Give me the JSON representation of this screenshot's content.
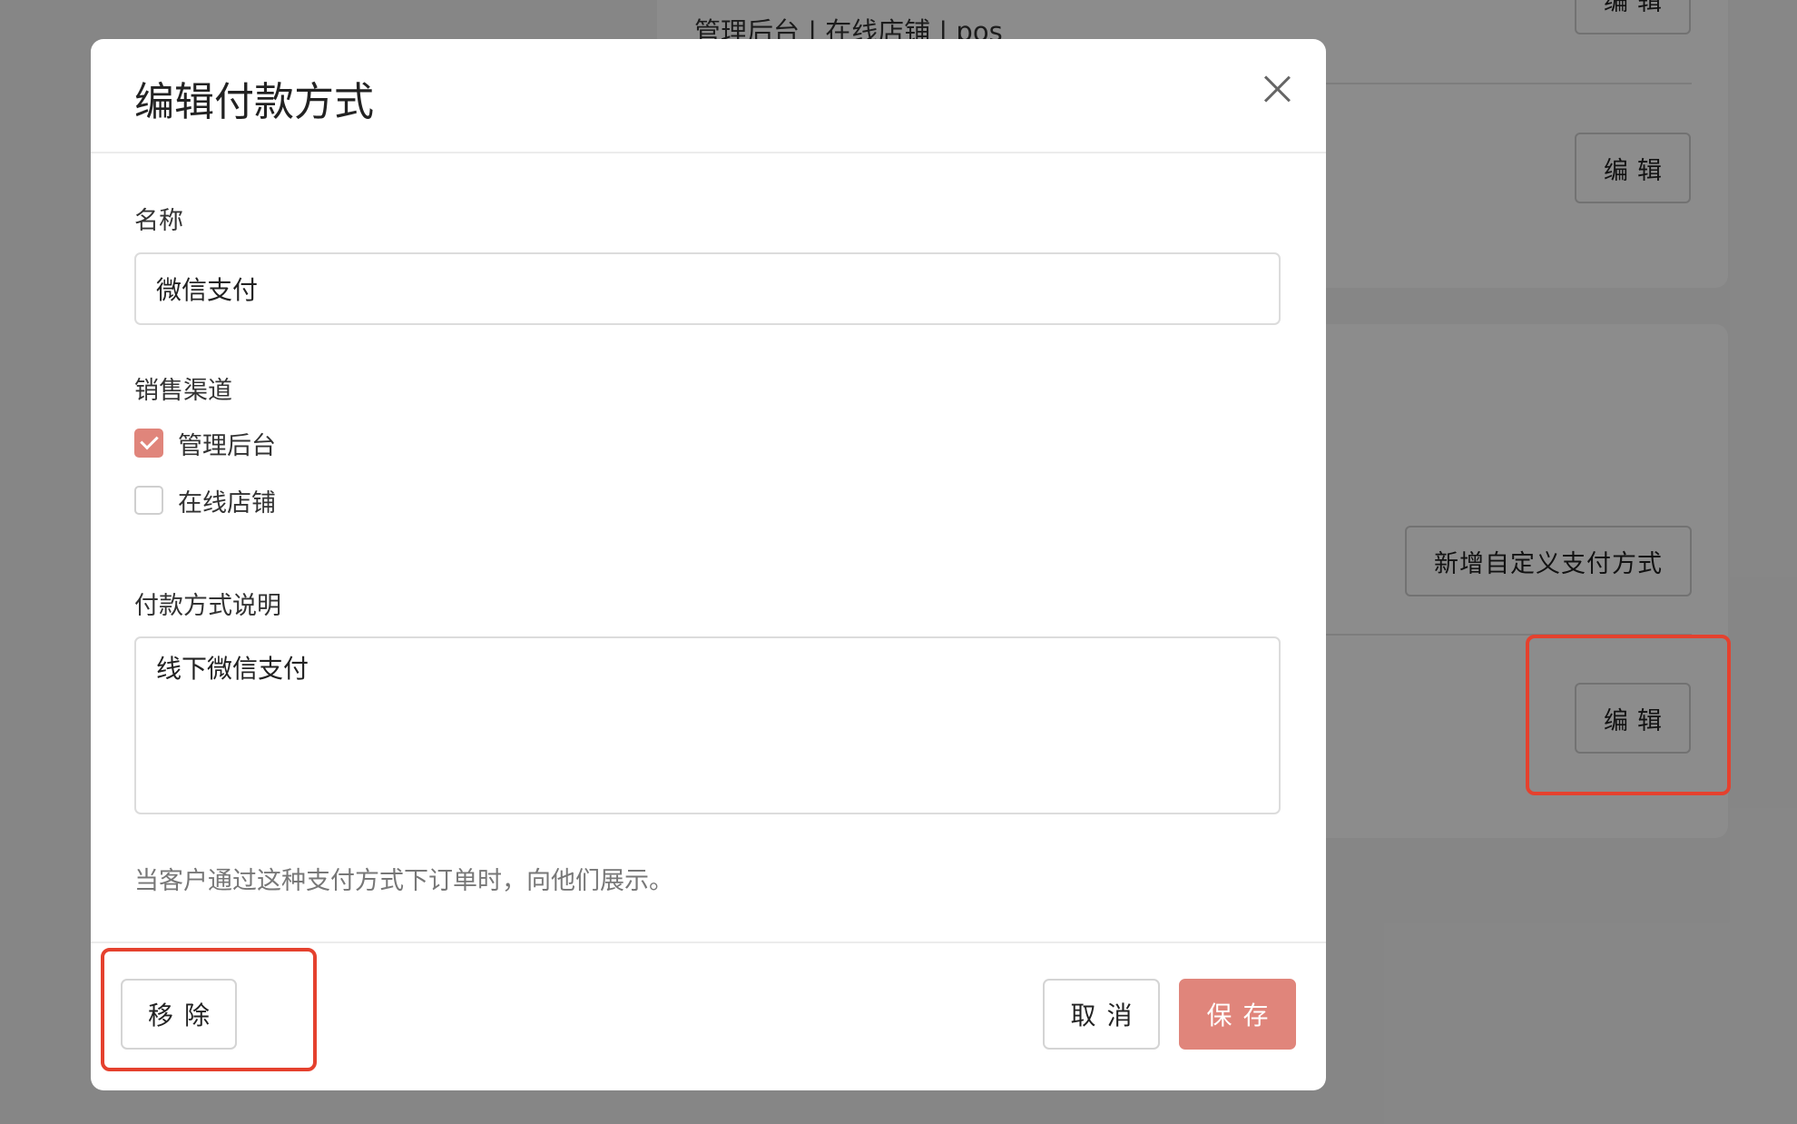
{
  "background": {
    "channels_text": "管理后台 | 在线店铺 | pos",
    "edit_label": "编辑",
    "add_custom_label": "新增自定义支付方式"
  },
  "modal": {
    "title": "编辑付款方式",
    "name_label": "名称",
    "name_value": "微信支付",
    "channels_label": "销售渠道",
    "channels": [
      {
        "label": "管理后台",
        "checked": true
      },
      {
        "label": "在线店铺",
        "checked": false
      }
    ],
    "description_label": "付款方式说明",
    "description_value": "线下微信支付",
    "help_text": "当客户通过这种支付方式下订单时，向他们展示。",
    "remove_label": "移除",
    "cancel_label": "取消",
    "save_label": "保存"
  },
  "colors": {
    "accent": "#e0857b",
    "highlight": "#e5412e"
  }
}
